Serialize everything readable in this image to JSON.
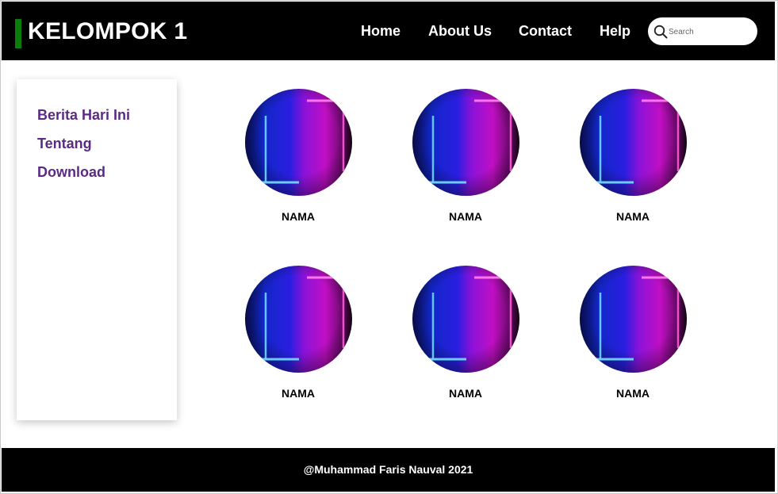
{
  "header": {
    "brand_title": "KELOMPOK 1",
    "brand_accent_color": "#0a7d0a",
    "nav": [
      {
        "label": "Home"
      },
      {
        "label": "About Us"
      },
      {
        "label": "Contact"
      },
      {
        "label": "Help"
      }
    ],
    "search": {
      "placeholder": "Search",
      "icon": "search-icon"
    }
  },
  "sidebar": {
    "link_color": "#5b2a86",
    "links": [
      {
        "label": "Berita Hari Ini"
      },
      {
        "label": "Tentang"
      },
      {
        "label": "Download"
      }
    ]
  },
  "gallery": {
    "cards": [
      {
        "name": "NAMA",
        "image": "neon-room-photo"
      },
      {
        "name": "NAMA",
        "image": "neon-room-photo"
      },
      {
        "name": "NAMA",
        "image": "neon-room-photo"
      },
      {
        "name": "NAMA",
        "image": "neon-room-photo"
      },
      {
        "name": "NAMA",
        "image": "neon-room-photo"
      },
      {
        "name": "NAMA",
        "image": "neon-room-photo"
      }
    ]
  },
  "footer": {
    "text": "@Muhammad Faris Nauval 2021"
  }
}
